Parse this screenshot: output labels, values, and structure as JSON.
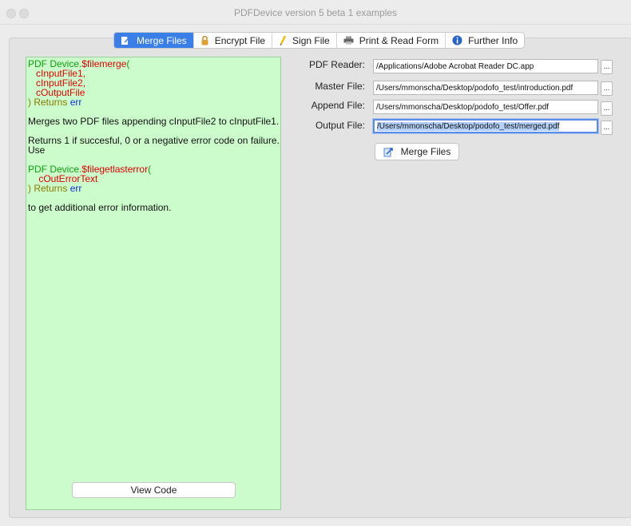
{
  "window": {
    "title": "PDFDevice version 5 beta 1 examples"
  },
  "tabs": [
    {
      "label": "Merge Files",
      "icon": "merge-icon"
    },
    {
      "label": "Encrypt File",
      "icon": "lock-icon"
    },
    {
      "label": "Sign File",
      "icon": "pen-icon"
    },
    {
      "label": "Print & Read Form",
      "icon": "printer-icon"
    },
    {
      "label": "Further Info",
      "icon": "info-icon"
    }
  ],
  "code": {
    "l1a": "PDF Device.",
    "l1b": "$filemerge",
    "l1c": "(",
    "p1": "cInputFile1,",
    "p2": "cInputFile2,",
    "p3": "cOutputFile",
    "ret1": ") Returns ",
    "err1": "err",
    "desc": "Merges two PDF files appending cInputFile2 to cInputFile1.",
    "returns1": "Returns 1 if succesful, 0 or a negative error code on failure.",
    "returns2": "Use",
    "l2a": "PDF Device.",
    "l2b": "$filegetlasterror",
    "l2c": "(",
    "p4": "cOutErrorText",
    "ret2": ") Returns ",
    "err2": "err",
    "tail": "to get additional error information."
  },
  "view_code_label": "View Code",
  "fields": {
    "reader_label": "PDF Reader:",
    "reader_value": "/Applications/Adobe Acrobat Reader DC.app",
    "master_label": "Master File:",
    "master_value": "/Users/mmonscha/Desktop/podofo_test/introduction.pdf",
    "append_label": "Append File:",
    "append_value": "/Users/mmonscha/Desktop/podofo_test/Offer.pdf",
    "output_label": "Output File:",
    "output_value": "/Users/mmonscha/Desktop/podofo_test/merged.pdf",
    "browse_label": "..."
  },
  "merge_button_label": "Merge Files",
  "colors": {
    "accent": "#3a7ee8",
    "code_bg": "#ccfccc"
  }
}
